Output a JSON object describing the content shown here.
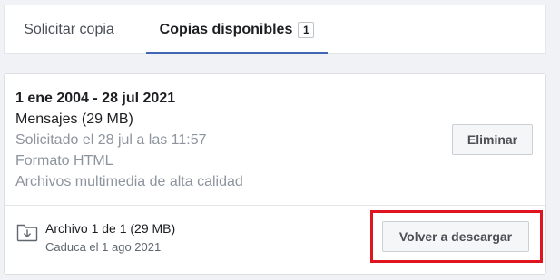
{
  "tabs": {
    "request_label": "Solicitar copia",
    "available_label": "Copias disponibles",
    "available_count": "1",
    "active_color": "#4267b2"
  },
  "copy": {
    "date_range": "1 ene 2004 - 28 jul 2021",
    "content": "Mensajes (29 MB)",
    "requested": "Solicitado el 28 jul a las 11:57",
    "format": "Formato HTML",
    "media_quality": "Archivos multimedia de alta calidad",
    "delete_label": "Eliminar"
  },
  "file": {
    "icon": "folder-download-icon",
    "title": "Archivo 1 de 1 (29 MB)",
    "expires": "Caduca el 1 ago 2021",
    "download_label": "Volver a descargar",
    "highlight_color": "#e0141e"
  }
}
